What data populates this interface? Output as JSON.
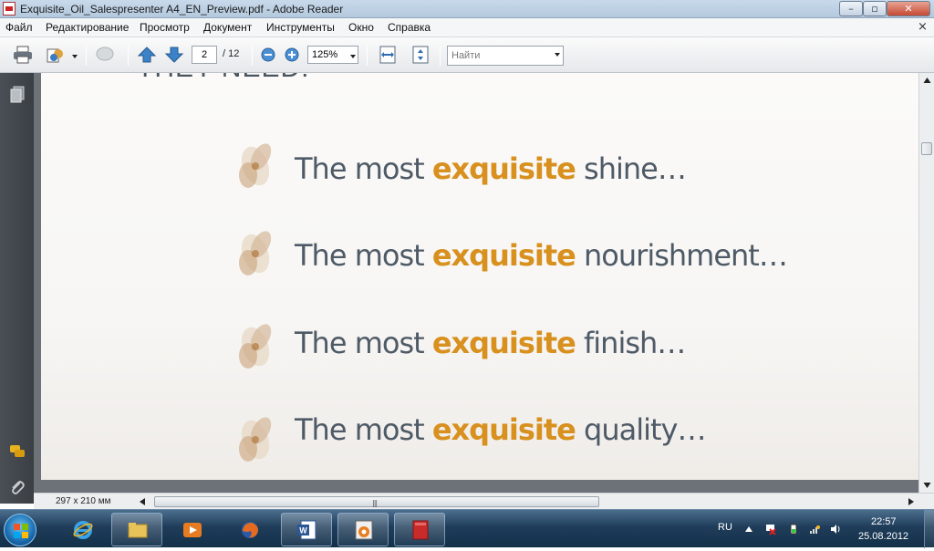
{
  "window": {
    "title": "Exquisite_Oil_Salespresenter A4_EN_Preview.pdf - Adobe Reader",
    "min_icon": "minimize-icon",
    "max_icon": "maximize-icon",
    "close_icon": "close-icon"
  },
  "menu": {
    "items": [
      "Файл",
      "Редактирование",
      "Просмотр",
      "Документ",
      "Инструменты",
      "Окно",
      "Справка"
    ],
    "close_glyph": "×"
  },
  "toolbar": {
    "page_current": "2",
    "page_total": "/ 12",
    "zoom": "125%",
    "search_placeholder": "Найти"
  },
  "document": {
    "partial_heading": "THEY NEED:",
    "lines": [
      {
        "prefix": "The most ",
        "highlight": "exquisite",
        "suffix": " shine…"
      },
      {
        "prefix": "The most ",
        "highlight": "exquisite",
        "suffix": " nourishment…"
      },
      {
        "prefix": "The most ",
        "highlight": "exquisite",
        "suffix": " finish…"
      },
      {
        "prefix": "The most ",
        "highlight": "exquisite",
        "suffix": " quality…"
      }
    ],
    "highlight_color": "#d8901e",
    "text_color": "#4e5a66"
  },
  "statusbar": {
    "page_size": "297 x 210 мм"
  },
  "taskbar": {
    "lang": "RU",
    "time": "22:57",
    "date": "25.08.2012",
    "apps": [
      "internet-explorer",
      "file-explorer",
      "media-player",
      "firefox",
      "word",
      "ico-app",
      "adobe-reader"
    ]
  }
}
